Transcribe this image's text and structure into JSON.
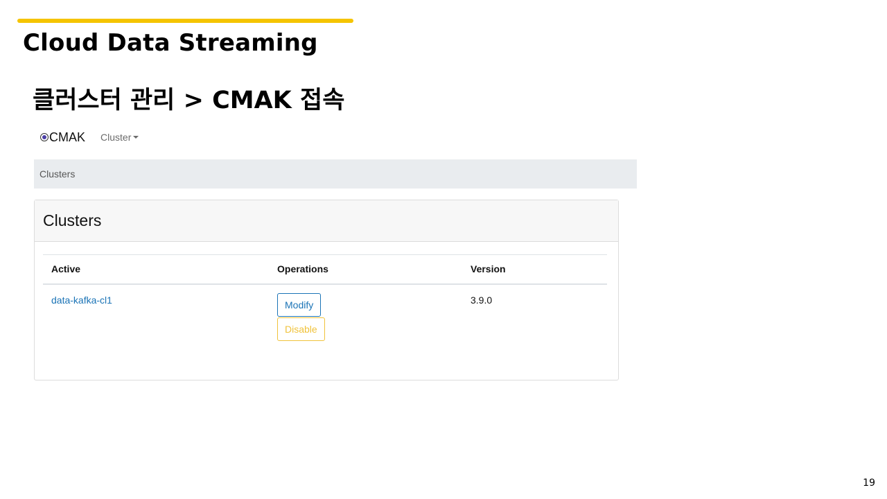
{
  "slide": {
    "title": "Cloud Data Streaming",
    "subtitle": "클러스터 관리 > CMAK 접속",
    "page_number": "19",
    "accent_color": "#f5c400"
  },
  "cmak": {
    "brand": "CMAK",
    "brand_icon": "cmak-logo-icon",
    "nav_menu": "Cluster",
    "breadcrumb": "Clusters",
    "card_title": "Clusters",
    "table": {
      "headers": [
        "Active",
        "Operations",
        "Version"
      ],
      "rows": [
        {
          "name": "data-kafka-cl1",
          "modify_label": "Modify",
          "disable_label": "Disable",
          "version": "3.9.0"
        }
      ]
    },
    "colors": {
      "link": "#1a73b6",
      "warning": "#f0c23a",
      "breadcrumb_bg": "#e9ecef"
    }
  }
}
